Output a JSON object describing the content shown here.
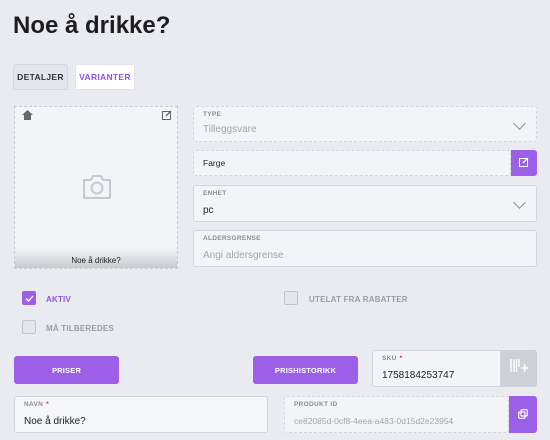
{
  "title": "Noe å drikke?",
  "tabs": [
    {
      "label": "DETALJER"
    },
    {
      "label": "VARIANTER"
    }
  ],
  "photo": {
    "caption": "Noe å drikke?"
  },
  "type_field": {
    "label": "TYPE",
    "value": "Tilleggsvare"
  },
  "color_field": {
    "value": "Farge"
  },
  "unit_field": {
    "label": "ENHET",
    "value": "pc"
  },
  "age_field": {
    "label": "ALDERSGRENSE",
    "placeholder": "Angi aldersgrense"
  },
  "checkboxes": {
    "active": {
      "label": "AKTIV",
      "checked": true
    },
    "exclude_discounts": {
      "label": "UTELAT FRA RABATTER",
      "checked": false
    },
    "must_prepare": {
      "label": "MÅ TILBEREDES",
      "checked": false
    }
  },
  "buttons": {
    "prices": "PRISER",
    "price_history": "PRISHISTORIKK"
  },
  "sku_field": {
    "label": "SKU",
    "required": "*",
    "value": "1758184253747"
  },
  "name_field": {
    "label": "NAVN",
    "required": "*",
    "value": "Noe å drikke?"
  },
  "product_id_field": {
    "label": "PRODUKT ID",
    "value": "ce82085d-0cf8-4eea-a483-0d15d2e23954"
  },
  "colors": {
    "accent": "#9b5fe8",
    "background": "#e9ebf0"
  }
}
